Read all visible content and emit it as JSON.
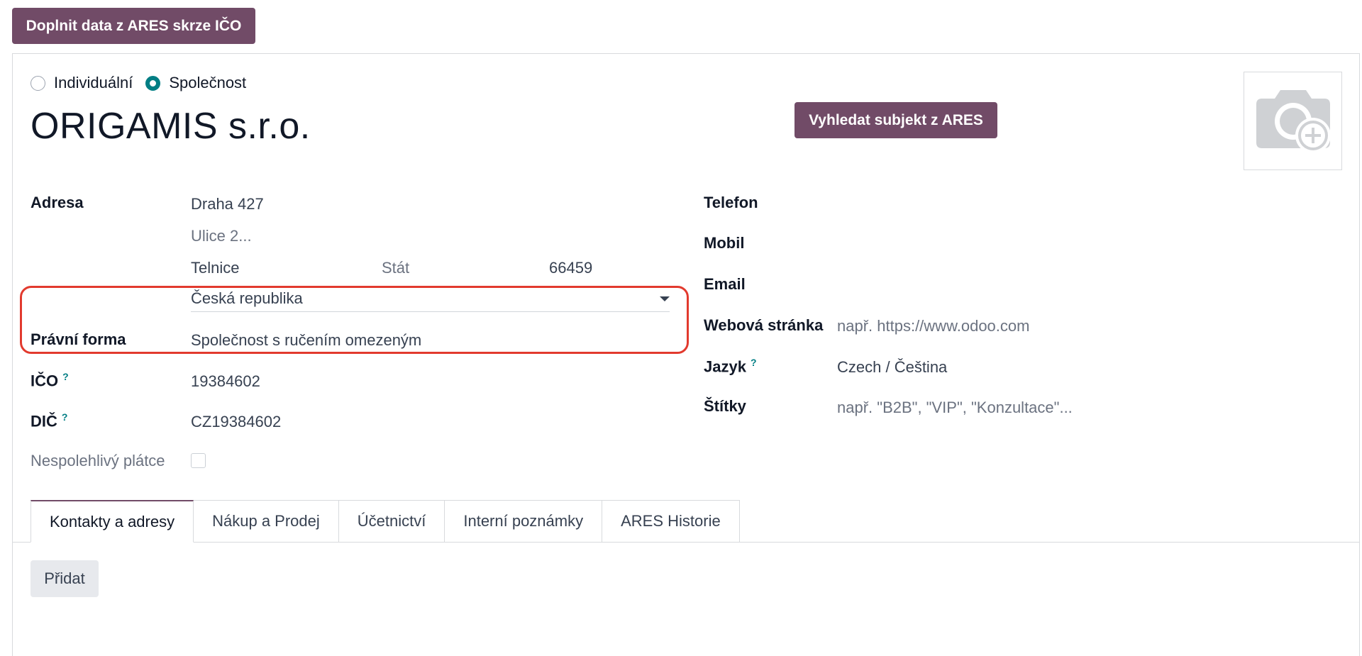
{
  "toolbar": {
    "fill_from_ares_label": "Doplnit data z ARES skrze IČO"
  },
  "partner_type": {
    "options": [
      {
        "label": "Individuální",
        "checked": false
      },
      {
        "label": "Společnost",
        "checked": true
      }
    ]
  },
  "company_name": "ORIGAMIS s.r.o.",
  "search_ares_label": "Vyhledat subjekt z ARES",
  "avatar_icon": "camera-plus-icon",
  "left_fields": {
    "address_label": "Adresa",
    "street": "Draha 427",
    "street2_placeholder": "Ulice 2...",
    "city": "Telnice",
    "state_placeholder": "Stát",
    "zip": "66459",
    "country": "Česká republika",
    "legal_form_label": "Právní forma",
    "legal_form": "Společnost s ručením omezeným",
    "ico_label": "IČO",
    "ico": "19384602",
    "dic_label": "DIČ",
    "dic": "CZ19384602",
    "unreliable_payer_label": "Nespolehlivý plátce",
    "help_mark": "?"
  },
  "right_fields": {
    "phone_label": "Telefon",
    "mobile_label": "Mobil",
    "email_label": "Email",
    "website_label": "Webová stránka",
    "website_placeholder": "např. https://www.odoo.com",
    "language_label": "Jazyk",
    "language": "Czech / Čeština",
    "tags_label": "Štítky",
    "tags_placeholder": "např. \"B2B\", \"VIP\", \"Konzultace\"..."
  },
  "tabs": [
    {
      "label": "Kontakty a adresy",
      "active": true
    },
    {
      "label": "Nákup a Prodej",
      "active": false
    },
    {
      "label": "Účetnictví",
      "active": false
    },
    {
      "label": "Interní poznámky",
      "active": false
    },
    {
      "label": "ARES Historie",
      "active": false
    }
  ],
  "add_label": "Přidat",
  "colors": {
    "primary": "#714B67",
    "accent": "#017e84",
    "highlight": "#e23a2e"
  }
}
